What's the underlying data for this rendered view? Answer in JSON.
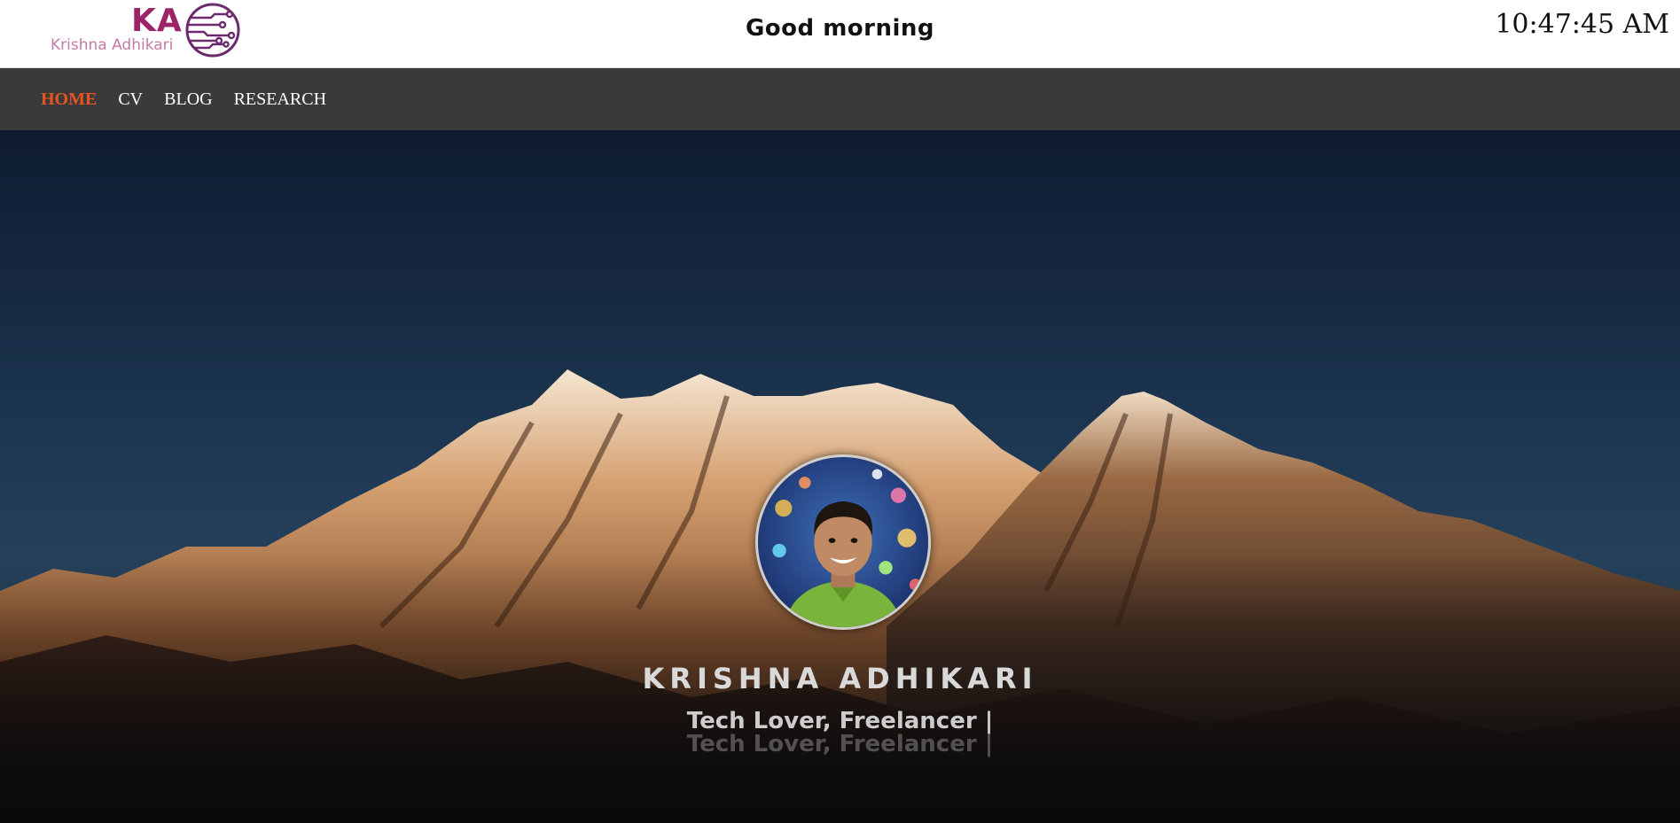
{
  "header": {
    "logo": {
      "initials": "KA",
      "name": "Krishna Adhikari",
      "icon": "circuit-globe-icon"
    },
    "greeting": "Good morning",
    "clock": "10:47:45 AM"
  },
  "nav": {
    "items": [
      {
        "label": "HOME",
        "active": true
      },
      {
        "label": "CV",
        "active": false
      },
      {
        "label": "BLOG",
        "active": false
      },
      {
        "label": "RESEARCH",
        "active": false
      }
    ],
    "active_color": "#e8541f"
  },
  "hero": {
    "background": "mountain-range-at-dawn",
    "avatar": "profile-photo",
    "name": "KRISHNA ADHIKARI",
    "tagline": "Tech Lover, Freelancer |"
  },
  "colors": {
    "brand": "#9b2466",
    "brand_light": "#c47ba4",
    "navbar": "#3a3a3a",
    "sky_top": "#0f1b30",
    "sky_mid": "#1f3a55"
  }
}
